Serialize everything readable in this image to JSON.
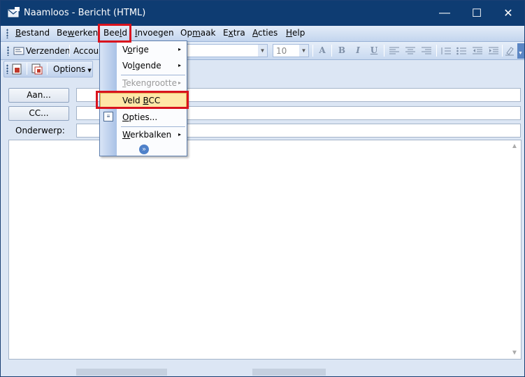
{
  "window": {
    "title": "Naamloos - Bericht (HTML)",
    "controls": {
      "minimize": "—",
      "maximize": "☐",
      "close": "✕"
    }
  },
  "menubar": {
    "items": [
      {
        "label_pre": "",
        "ul": "B",
        "label_post": "estand"
      },
      {
        "label_pre": "Be",
        "ul": "w",
        "label_post": "erken"
      },
      {
        "label_pre": "Bee",
        "ul": "l",
        "label_post": "d"
      },
      {
        "label_pre": "",
        "ul": "I",
        "label_post": "nvoegen"
      },
      {
        "label_pre": "Op",
        "ul": "m",
        "label_post": "aak"
      },
      {
        "label_pre": "E",
        "ul": "x",
        "label_post": "tra"
      },
      {
        "label_pre": "",
        "ul": "A",
        "label_post": "cties"
      },
      {
        "label_pre": "",
        "ul": "H",
        "label_post": "elp"
      }
    ]
  },
  "toolbar": {
    "send_label": "Verzenden",
    "accounts_label": "Accou",
    "font_size_value": "10",
    "options_label": "Options",
    "format_icons": [
      "A",
      "B",
      "I",
      "U"
    ]
  },
  "address": {
    "to_button": "Aan...",
    "cc_button": "CC...",
    "subject_label": "Onderwerp:"
  },
  "dropdown": {
    "items": [
      {
        "pre": "V",
        "ul": "o",
        "post": "rige",
        "submenu": "▸"
      },
      {
        "pre": "Vo",
        "ul": "l",
        "post": "gende",
        "submenu": "▸"
      },
      {
        "pre": "",
        "ul": "T",
        "post": "ekengrootte",
        "submenu": "▸"
      },
      {
        "pre": "Veld ",
        "ul": "B",
        "post": "CC",
        "submenu": ""
      },
      {
        "pre": "",
        "ul": "O",
        "post": "pties...",
        "submenu": ""
      },
      {
        "pre": "",
        "ul": "W",
        "post": "erkbalken",
        "submenu": "▸"
      }
    ],
    "expand_glyph": "»"
  },
  "colors": {
    "titlebar": "#0e3c72",
    "highlight": "#d9131e",
    "hover": "#ffe7a7"
  }
}
